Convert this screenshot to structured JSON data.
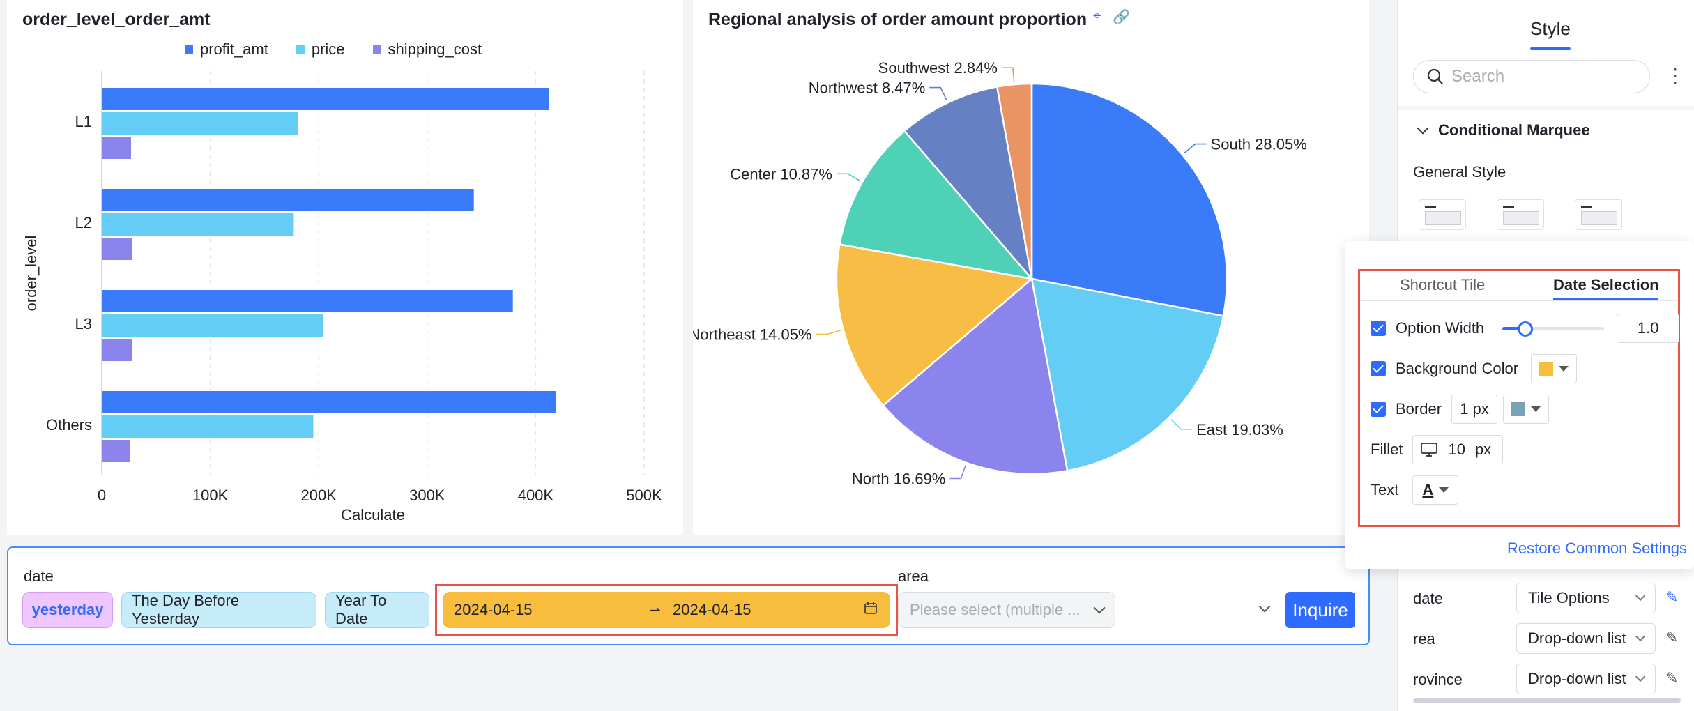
{
  "bar_chart": {
    "title": "order_level_order_amt",
    "chart_data": {
      "type": "bar",
      "orientation": "horizontal",
      "categories": [
        "L1",
        "L2",
        "L3",
        "Others"
      ],
      "series": [
        {
          "name": "profit_amt",
          "color": "#3a7bfa",
          "values": [
            412000,
            343000,
            379000,
            419000
          ]
        },
        {
          "name": "price",
          "color": "#63cdf6",
          "values": [
            181000,
            177000,
            204000,
            195000
          ]
        },
        {
          "name": "shipping_cost",
          "color": "#8b84ec",
          "values": [
            27000,
            28000,
            28000,
            26000
          ]
        }
      ],
      "xticks": [
        "0",
        "100K",
        "200K",
        "300K",
        "400K",
        "500K"
      ],
      "xlim": [
        0,
        500000
      ],
      "xlabel": "Calculate",
      "ylabel": "order_level",
      "grid": "vertical-dashed",
      "legend": "top"
    }
  },
  "pie_chart": {
    "title": "Regional analysis of order amount proportion",
    "chart_data": {
      "type": "pie",
      "slices": [
        {
          "label": "South 28.05%",
          "value": 28.05,
          "color": "#3a7bfa"
        },
        {
          "label": "East 19.03%",
          "value": 19.03,
          "color": "#63cdf6"
        },
        {
          "label": "North 16.69%",
          "value": 16.69,
          "color": "#8b84ec"
        },
        {
          "label": "Northeast 14.05%",
          "value": 14.05,
          "color": "#f8bd45"
        },
        {
          "label": "Center 10.87%",
          "value": 10.87,
          "color": "#4fd1b8"
        },
        {
          "label": "Northwest 8.47%",
          "value": 8.47,
          "color": "#6581c4"
        },
        {
          "label": "Southwest 2.84%",
          "value": 2.84,
          "color": "#ea9463"
        }
      ]
    }
  },
  "filter": {
    "date_label": "date",
    "chips": [
      "yesterday",
      "The Day Before Yesterday",
      "Year To Date"
    ],
    "range_start": "2024-04-15",
    "range_end": "2024-04-15",
    "area_label": "area",
    "area_placeholder": "Please select (multiple ...",
    "inquire_label": "Inquire"
  },
  "panel": {
    "tab": "Style",
    "search_placeholder": "Search",
    "section": "Conditional Marquee",
    "general_style": "General Style",
    "rows": [
      {
        "label": "date",
        "value": "Tile Options"
      },
      {
        "label": "rea",
        "value": "Drop-down list"
      },
      {
        "label": "rovince",
        "value": "Drop-down list"
      }
    ]
  },
  "popover": {
    "tab_shortcut": "Shortcut Tile",
    "tab_date": "Date Selection",
    "option_width_label": "Option Width",
    "option_width_value": "1.0",
    "option_width_slider": 0.2,
    "bg_color_label": "Background Color",
    "bg_color": "#f8bd3c",
    "border_label": "Border",
    "border_width": "1",
    "border_unit": "px",
    "border_color": "#7aa3b8",
    "fillet_label": "Fillet",
    "fillet_value": "10",
    "fillet_unit": "px",
    "text_label": "Text",
    "text_glyph": "A",
    "restore_label": "Restore Common Settings"
  }
}
